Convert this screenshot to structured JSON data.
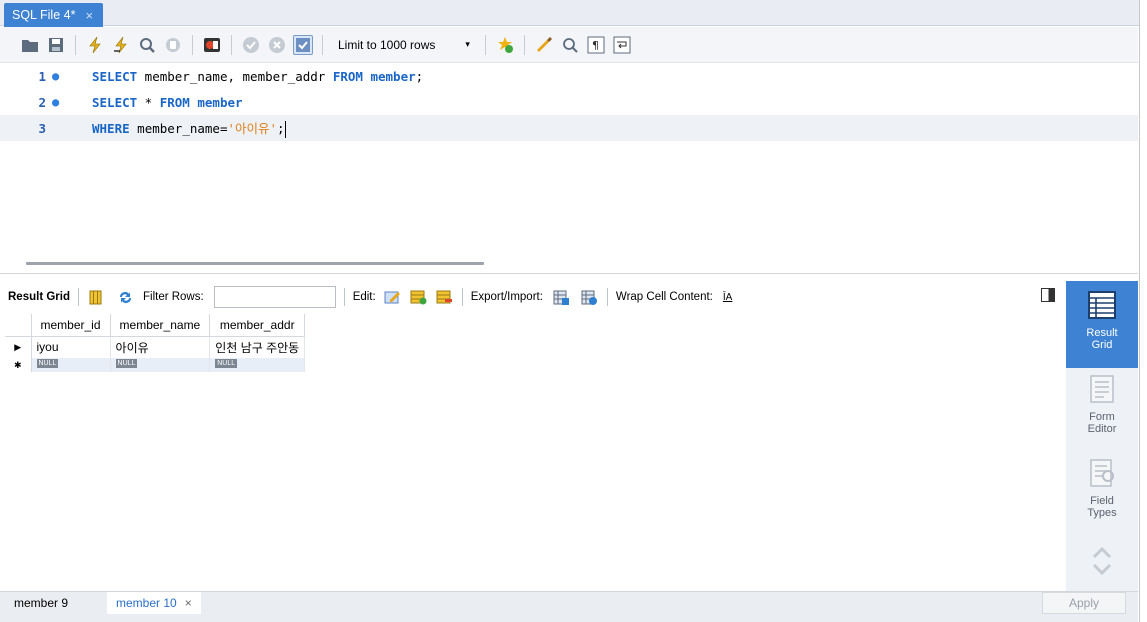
{
  "tab": {
    "title": "SQL File 4*",
    "close": "×"
  },
  "toolbar": {
    "limit_label": "Limit to 1000 rows",
    "limit_arrow": "▾",
    "icons": [
      "open-folder-icon",
      "save-icon",
      "execute-icon",
      "execute-current-icon",
      "explain-icon",
      "stop-icon",
      "toggle-error-icon",
      "commit-icon",
      "rollback-icon",
      "autocommit-icon",
      "beautify-icon",
      "snippet-icon",
      "find-icon",
      "invisible-chars-icon",
      "wrap-icon"
    ]
  },
  "editor": {
    "lines": [
      {
        "num": "1",
        "dot": "●",
        "kw1": "SELECT",
        "t1": " member_name, member_addr ",
        "kw2": "FROM",
        "t2": " ",
        "kw3": "member",
        "t3": ";"
      },
      {
        "num": "2",
        "dot": "●",
        "kw1": "SELECT",
        "t1": " * ",
        "kw2": "FROM",
        "t2": " ",
        "kw3": "member",
        "t3": ""
      },
      {
        "num": "3",
        "dot": "",
        "kw1": "WHERE",
        "t1": " member_name=",
        "str": "'아이유'",
        "t3": ";"
      }
    ]
  },
  "results_toolbar": {
    "result_grid": "Result Grid",
    "filter_rows": "Filter Rows:",
    "edit": "Edit:",
    "export_import": "Export/Import:",
    "wrap_cell": "Wrap Cell Content:",
    "wrap_glyph": "ĪA"
  },
  "grid": {
    "columns": [
      "member_id",
      "member_name",
      "member_addr"
    ],
    "rows": [
      {
        "marker": "▶",
        "cells": [
          "iyou",
          "아이유",
          "인천 남구 주안동"
        ]
      }
    ],
    "new_row_marker": "✱",
    "null_label": "NULL"
  },
  "sidepanel": {
    "result_grid": "Result\nGrid",
    "form_editor": "Form\nEditor",
    "field_types": "Field\nTypes"
  },
  "bottom": {
    "tab1": "member 9",
    "tab2": "member 10",
    "tab2_close": "×",
    "apply": "Apply"
  },
  "colors": {
    "accent": "#3d82d3",
    "keyword": "#1a66c8",
    "string": "#e07f1a"
  }
}
